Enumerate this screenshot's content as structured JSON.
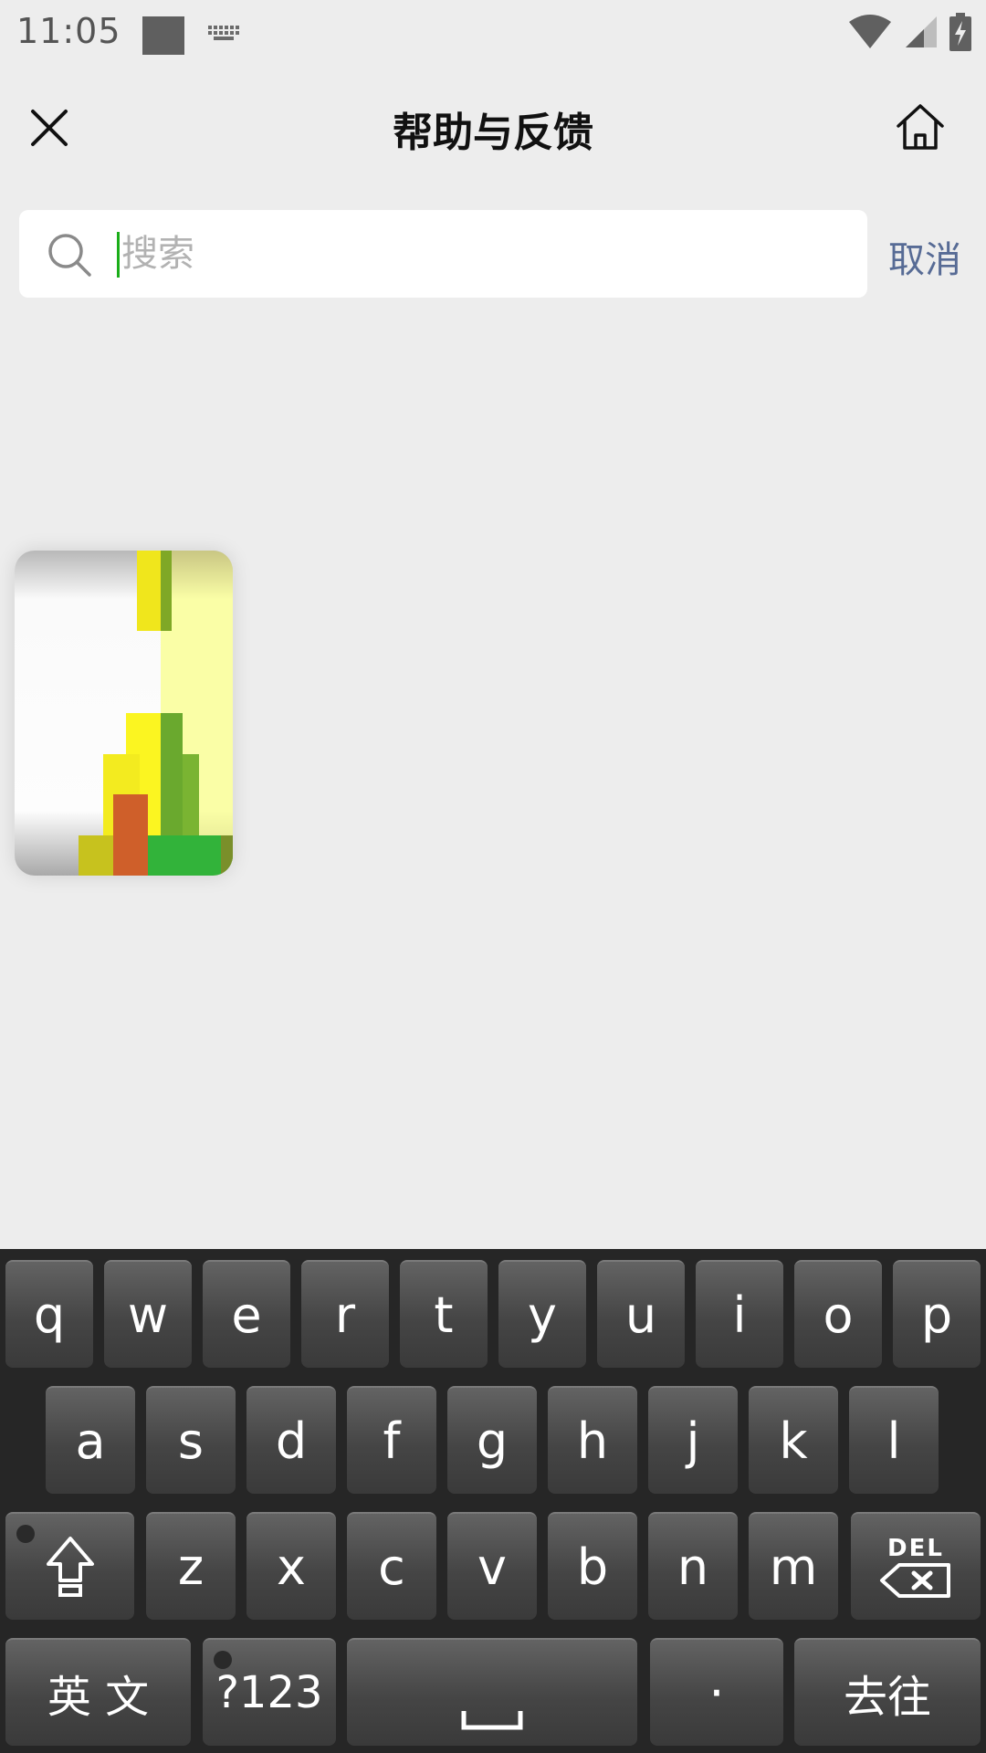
{
  "status_bar": {
    "time": "11:05",
    "icons": [
      "notification-square-icon",
      "keyboard-icon",
      "wifi-icon",
      "signal-icon",
      "battery-charging-icon"
    ]
  },
  "header": {
    "title": "帮助与反馈",
    "close_icon": "close-icon",
    "home_icon": "home-icon"
  },
  "search": {
    "placeholder": "搜索",
    "value": "",
    "cancel_label": "取消"
  },
  "keyboard": {
    "row1": [
      "q",
      "w",
      "e",
      "r",
      "t",
      "y",
      "u",
      "i",
      "o",
      "p"
    ],
    "row2": [
      "a",
      "s",
      "d",
      "f",
      "g",
      "h",
      "j",
      "k",
      "l"
    ],
    "row3": [
      "z",
      "x",
      "c",
      "v",
      "b",
      "n",
      "m"
    ],
    "shift_icon": "shift-icon",
    "delete_label": "DEL",
    "lang_label": "英 文",
    "symbols_label": "?123",
    "space_icon": "space-bar-icon",
    "period_label": "·",
    "go_label": "去往"
  },
  "colors": {
    "accent_green": "#1aad19",
    "link_blue": "#576b95",
    "page_bg": "#ededed"
  }
}
